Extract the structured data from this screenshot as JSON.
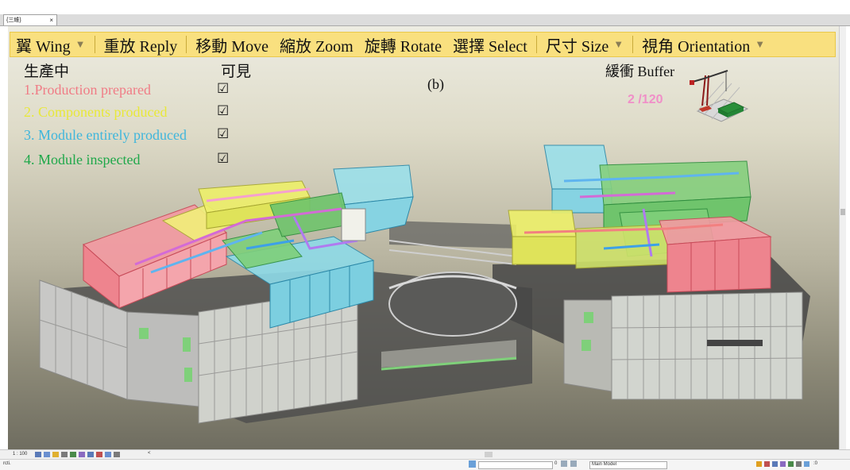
{
  "tab": {
    "label": "{三維}",
    "close": "×"
  },
  "menu": {
    "wing": "翼 Wing",
    "reply": "重放 Reply",
    "move": "移動 Move",
    "zoom": "縮放 Zoom",
    "rotate": "旋轉 Rotate",
    "select": "選擇 Select",
    "size": "尺寸 Size",
    "orientation": "視角 Orientation",
    "dropdown_glyph": "▼"
  },
  "legend": {
    "heading": "生產中",
    "visible_heading": "可見",
    "items": [
      {
        "label": "1.Production prepared",
        "color": "#f07c86",
        "checked": "☑"
      },
      {
        "label": "2. Components produced",
        "color": "#e8e83a",
        "checked": "☑"
      },
      {
        "label": "3. Module entirely produced",
        "color": "#3fb6dc",
        "checked": "☑"
      },
      {
        "label": "4. Module inspected",
        "color": "#1fa84a",
        "checked": "☑"
      }
    ]
  },
  "subfigure_label": "(b)",
  "buffer": {
    "heading": "緩衝 Buffer",
    "count": "2 /120"
  },
  "statusbar": {
    "scale": "1 : 100",
    "expand": "<"
  },
  "bottombar": {
    "left_text": "rcti.",
    "model": "Main Model",
    "zero": "0",
    "filter": ":0"
  },
  "colors": {
    "menu_bg": "#f9e07f",
    "production_prepared": "#f07c86",
    "components_produced": "#e8e83a",
    "module_entirely_produced": "#3fb6dc",
    "module_inspected": "#1fa84a"
  }
}
